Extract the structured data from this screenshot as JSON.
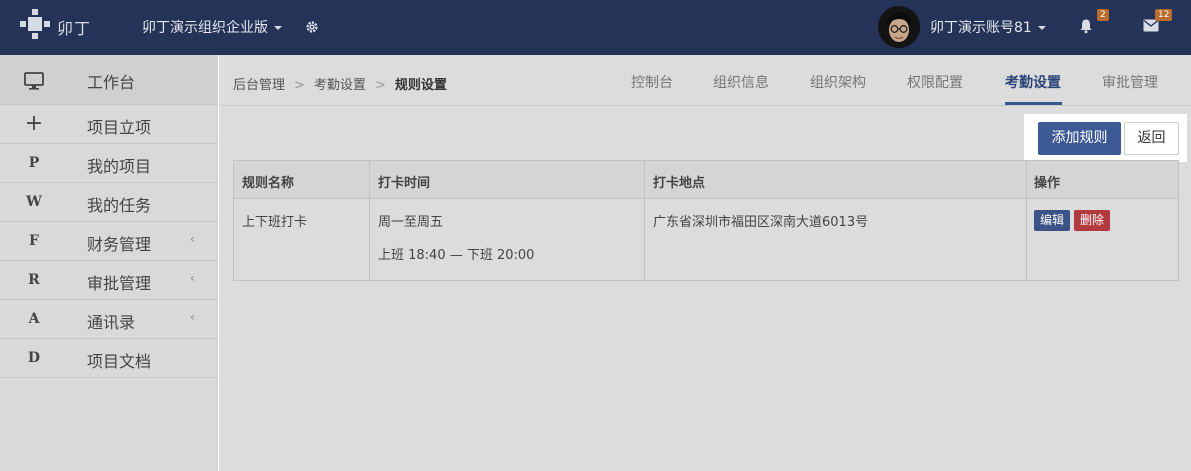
{
  "header": {
    "logo_text": "卯丁",
    "org_name": "卯丁演示组织企业版",
    "account_name": "卯丁演示账号81",
    "notification_count": "2",
    "message_count": "12"
  },
  "sidebar": {
    "workbench": "工作台",
    "items": [
      {
        "icon": "+",
        "label": "项目立项",
        "has_arrow": false
      },
      {
        "icon": "P",
        "label": "我的项目",
        "has_arrow": false
      },
      {
        "icon": "W",
        "label": "我的任务",
        "has_arrow": false
      },
      {
        "icon": "F",
        "label": "财务管理",
        "has_arrow": true
      },
      {
        "icon": "R",
        "label": "审批管理",
        "has_arrow": true
      },
      {
        "icon": "A",
        "label": "通讯录",
        "has_arrow": true
      },
      {
        "icon": "D",
        "label": "项目文档",
        "has_arrow": false
      }
    ],
    "arrow": "‹"
  },
  "breadcrumb": {
    "items": [
      "后台管理",
      "考勤设置",
      "规则设置"
    ],
    "separator": ">"
  },
  "tabs": [
    {
      "label": "控制台",
      "active": false
    },
    {
      "label": "组织信息",
      "active": false
    },
    {
      "label": "组织架构",
      "active": false
    },
    {
      "label": "权限配置",
      "active": false
    },
    {
      "label": "考勤设置",
      "active": true
    },
    {
      "label": "审批管理",
      "active": false
    }
  ],
  "actions": {
    "add_rule": "添加规则",
    "back": "返回"
  },
  "table": {
    "headers": [
      "规则名称",
      "打卡时间",
      "打卡地点",
      "操作"
    ],
    "rows": [
      {
        "name": "上下班打卡",
        "days": "周一至周五",
        "hours": "上班 18:40 — 下班 20:00",
        "location": "广东省深圳市福田区深南大道6013号",
        "edit": "编辑",
        "delete": "删除"
      }
    ]
  },
  "colors": {
    "header_bg": "#263358",
    "primary": "#3e5a96",
    "danger": "#b23a3f",
    "badge": "#b86d2c"
  }
}
